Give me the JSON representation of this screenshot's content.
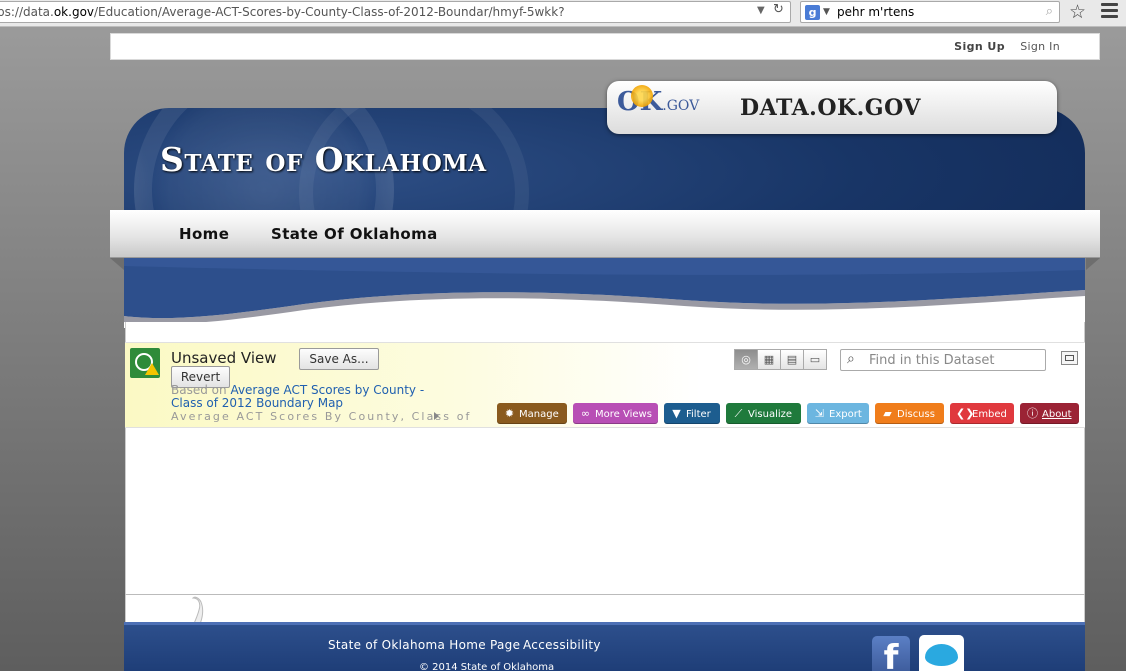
{
  "browser": {
    "url_prefix": "ps://data.",
    "url_host": "ok.gov",
    "url_path": "/Education/Average-ACT-Scores-by-County-Class-of-2012-Boundar/hmyf-5wkk?",
    "search_engine_icon": "google-icon",
    "search_query": "pehr m'rtens"
  },
  "topbar": {
    "sign_up": "Sign Up",
    "sign_in": "Sign In"
  },
  "header": {
    "state_title": "State of Oklahoma",
    "okgov_logo_ok": "OK",
    "okgov_logo_gov": ".GOV",
    "site_title": "DATA.OK.GOV"
  },
  "nav": {
    "items": [
      {
        "label": "Home"
      },
      {
        "label": "State Of Oklahoma"
      }
    ]
  },
  "view": {
    "title": "Unsaved View",
    "save_as": "Save As...",
    "revert": "Revert",
    "based_on_prefix": "Based on",
    "based_on_link": "Average ACT Scores by County - Class of 2012 Boundary Map",
    "description": "Average ACT Scores By County, Class of",
    "find_placeholder": "Find in this Dataset",
    "actions": [
      {
        "label": "Manage",
        "icon": "gear-icon",
        "color": "#8a5a1e"
      },
      {
        "label": "More Views",
        "icon": "binoculars-icon",
        "color": "#b84fb5"
      },
      {
        "label": "Filter",
        "icon": "funnel-icon",
        "color": "#1d5d8f"
      },
      {
        "label": "Visualize",
        "icon": "chart-icon",
        "color": "#1f7a3c"
      },
      {
        "label": "Export",
        "icon": "export-icon",
        "color": "#6cb6e0"
      },
      {
        "label": "Discuss",
        "icon": "speech-bubble-icon",
        "color": "#f07d1b"
      },
      {
        "label": "Embed",
        "icon": "embed-icon",
        "color": "#e0393e"
      },
      {
        "label": "About",
        "icon": "info-icon",
        "color": "#9b2335"
      }
    ]
  },
  "footer": {
    "links": [
      {
        "label": "State of Oklahoma Home Page"
      },
      {
        "label": "Accessibility"
      }
    ],
    "copyright": "© 2014 State of Oklahoma"
  }
}
